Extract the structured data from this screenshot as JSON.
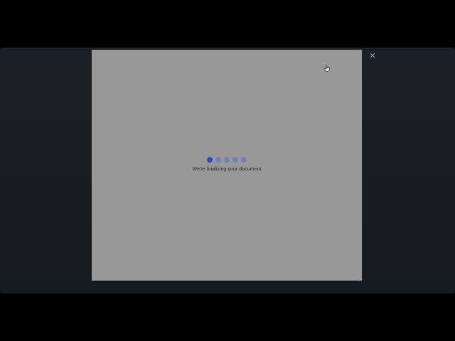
{
  "dialog": {
    "close_icon": "close-icon",
    "loading": {
      "dot_count": 5,
      "active_index": 0,
      "active_color": "#2f48c6",
      "inactive_color": "#7380b8",
      "message": "We're finalizing your document"
    },
    "cursor_icon": "hand-pointer-icon"
  }
}
